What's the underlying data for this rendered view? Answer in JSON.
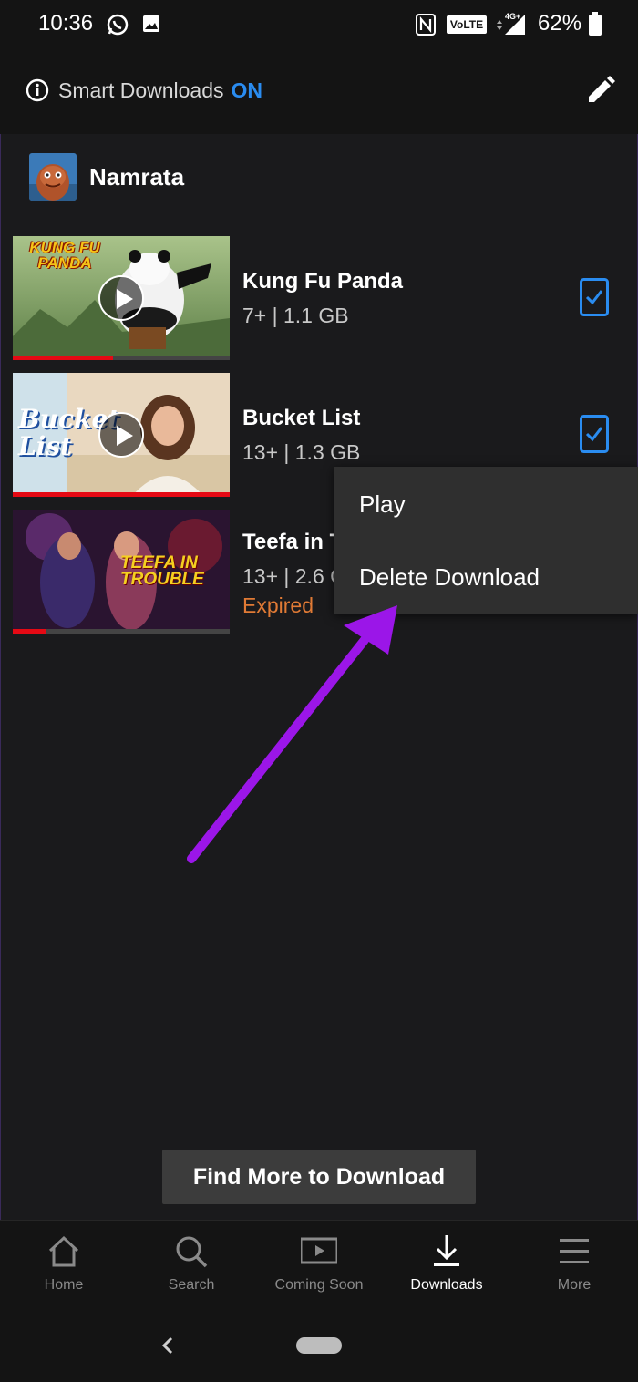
{
  "status_bar": {
    "time": "10:36",
    "battery": "62%",
    "icons": [
      "whatsapp-icon",
      "gallery-icon",
      "nfc-icon",
      "volte-icon",
      "signal-icon",
      "battery-icon"
    ],
    "volte_label": "VoLTE"
  },
  "header": {
    "smart_downloads_label": "Smart Downloads",
    "smart_downloads_state": "ON",
    "accent": "#2a8cf0"
  },
  "profile": {
    "name": "Namrata"
  },
  "downloads": [
    {
      "title": "Kung Fu Panda",
      "meta": "7+ | 1.1 GB",
      "progress": 0.46,
      "thumb_text": "KUNG FU PANDA",
      "selected": true
    },
    {
      "title": "Bucket List",
      "meta": "13+ | 1.3 GB",
      "progress": 1.0,
      "thumb_text": "Bucket List",
      "selected": true
    },
    {
      "title": "Teefa in T",
      "meta": "13+ | 2.6 G",
      "status": "Expired",
      "progress": 0.15,
      "thumb_text": "TEEFA IN TROUBLE"
    }
  ],
  "context_menu": {
    "items": [
      "Play",
      "Delete Download"
    ]
  },
  "find_more_label": "Find More to Download",
  "bottom_nav": [
    {
      "label": "Home",
      "icon": "home-icon"
    },
    {
      "label": "Search",
      "icon": "search-icon"
    },
    {
      "label": "Coming Soon",
      "icon": "coming-soon-icon"
    },
    {
      "label": "Downloads",
      "icon": "download-icon",
      "active": true
    },
    {
      "label": "More",
      "icon": "menu-icon"
    }
  ],
  "colors": {
    "background": "#1a1a1c",
    "progress": "#e50914",
    "expired": "#e07a35",
    "annotation_arrow": "#9b16e8"
  }
}
